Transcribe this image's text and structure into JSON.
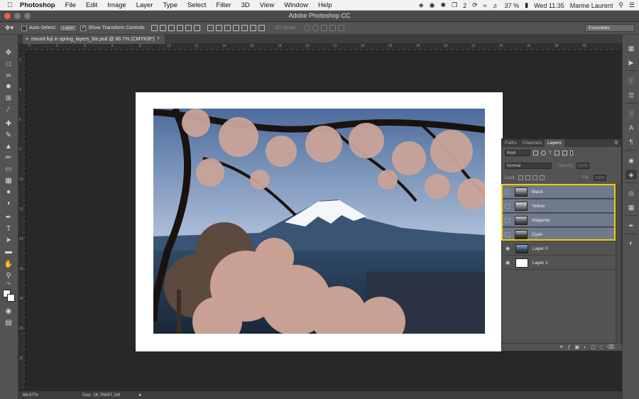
{
  "menubar": {
    "app": "Photoshop",
    "items": [
      "File",
      "Edit",
      "Image",
      "Layer",
      "Type",
      "Select",
      "Filter",
      "3D",
      "View",
      "Window",
      "Help"
    ],
    "status_count": "2",
    "battery": "37 %",
    "clock": "Wed 11:35",
    "user": "Marine Laurent"
  },
  "window": {
    "title": "Adobe Photoshop CC"
  },
  "options": {
    "auto_select_label": "Auto-Select:",
    "auto_select_value": "Layer",
    "show_transform_label": "Show Transform Controls",
    "mode_3d_label": "3D Mode:",
    "workspace": "Essentials"
  },
  "document": {
    "tab_title": "mount fuji in spring_layers_bis.psd @ 66.7% (CMYK/8*)",
    "tab_close": "×",
    "tab_modified": "*",
    "zoom": "66.67%",
    "doc_size": "Doc: 16,7M/87,1M"
  },
  "rulers": {
    "top": [
      "0",
      "2",
      "4",
      "6",
      "8",
      "10",
      "12",
      "14",
      "16",
      "18",
      "20",
      "22",
      "24",
      "26",
      "28",
      "30",
      "32",
      "34",
      "36",
      "38",
      "40"
    ],
    "left": [
      "2",
      "4",
      "6",
      "8",
      "10",
      "12",
      "14",
      "16",
      "18",
      "20",
      "22"
    ]
  },
  "layers_panel": {
    "tabs": [
      "Paths",
      "Channels",
      "Layers"
    ],
    "active_tab": "Layers",
    "kind": "Kind",
    "blend_mode": "Normal",
    "opacity_label": "Opacity:",
    "opacity_value": "100%",
    "lock_label": "Lock:",
    "fill_label": "Fill:",
    "fill_value": "100%",
    "layers": [
      {
        "name": "Black",
        "visible": false,
        "selected": true
      },
      {
        "name": "Yellow",
        "visible": false,
        "selected": true
      },
      {
        "name": "Magenta",
        "visible": false,
        "selected": true
      },
      {
        "name": "Cyan",
        "visible": false,
        "selected": true
      },
      {
        "name": "Layer 0",
        "visible": true,
        "selected": false
      },
      {
        "name": "Layer 1",
        "visible": true,
        "selected": false
      }
    ]
  },
  "colors": {
    "highlight": "#f2cc00",
    "selected_row": "#6f7b8c",
    "panel_bg": "#535353",
    "canvas_bg": "#282828"
  }
}
